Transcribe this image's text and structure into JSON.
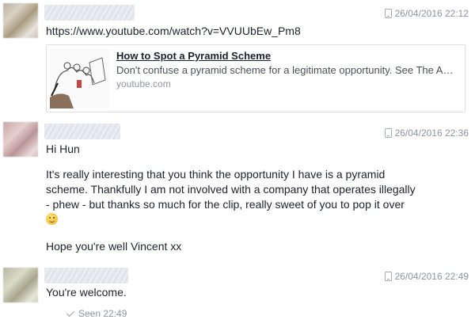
{
  "messages": [
    {
      "timestamp": "26/04/2016 22:12",
      "url": "https://www.youtube.com/watch?v=VVUUbEw_Pm8",
      "card": {
        "title": "How to Spot a Pyramid Scheme",
        "description": "Don't confuse a pyramid scheme for a legitimate opportunity. See The Am...",
        "domain": "youtube.com"
      }
    },
    {
      "timestamp": "26/04/2016 22:36",
      "greeting": "Hi Hun",
      "body_1": "It's really interesting that you think the opportunity I have is a pyramid scheme. Thankfully I am not involved with a company that operates illegally - phew - but thanks so much for the clip, really sweet of you to pop it over",
      "body_2": "Hope you're well Vincent xx"
    },
    {
      "timestamp": "26/04/2016 22:49",
      "text": "You're welcome.",
      "seen": "Seen 22:49"
    }
  ],
  "icons": {
    "timestamp": "phone-icon",
    "seen": "check-icon",
    "emoji": "smiley-icon"
  }
}
